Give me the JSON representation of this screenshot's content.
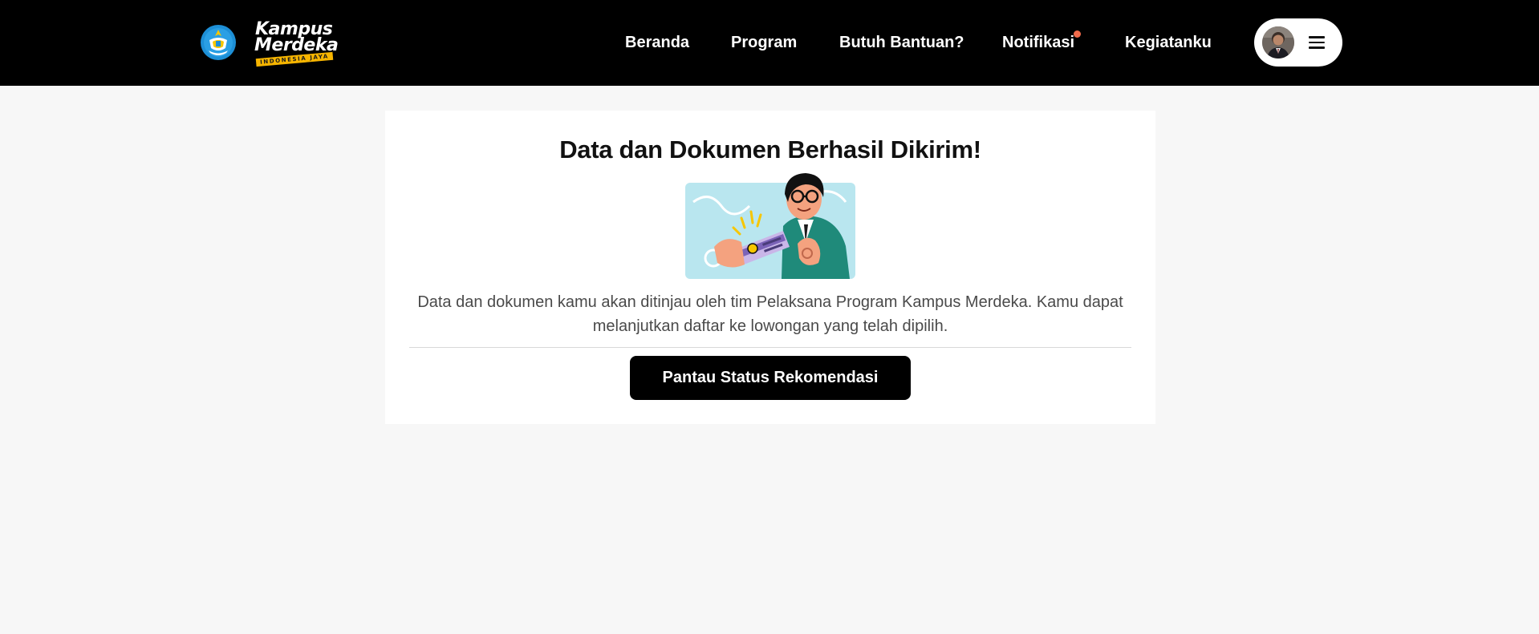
{
  "brand": {
    "logo_line1": "Kampus",
    "logo_line2": "Merdeka",
    "logo_tagline": "INDONESIA JAYA",
    "emblem_icon": "tut-wuri-handayani-emblem-icon"
  },
  "nav": {
    "items": [
      {
        "label": "Beranda"
      },
      {
        "label": "Program"
      },
      {
        "label": "Butuh Bantuan?"
      },
      {
        "label": "Notifikasi",
        "has_badge": true
      },
      {
        "label": "Kegiatanku"
      }
    ],
    "profile_menu_icon": "hamburger-menu-icon"
  },
  "main": {
    "title": "Data dan Dokumen Berhasil Dikirim!",
    "description": "Data dan dokumen kamu akan ditinjau oleh tim Pelaksana Program Kampus Merdeka. Kamu dapat melanjutkan daftar ke lowongan yang telah dipilih.",
    "cta_label": "Pantau Status Rekomendasi",
    "illustration_icon": "person-holding-id-card-illustration"
  },
  "colors": {
    "header_bg": "#000000",
    "page_bg": "#f7f7f7",
    "card_bg": "#ffffff",
    "button_bg": "#000000",
    "notification_dot": "#f26b4b",
    "logo_accent": "#f7b500"
  }
}
